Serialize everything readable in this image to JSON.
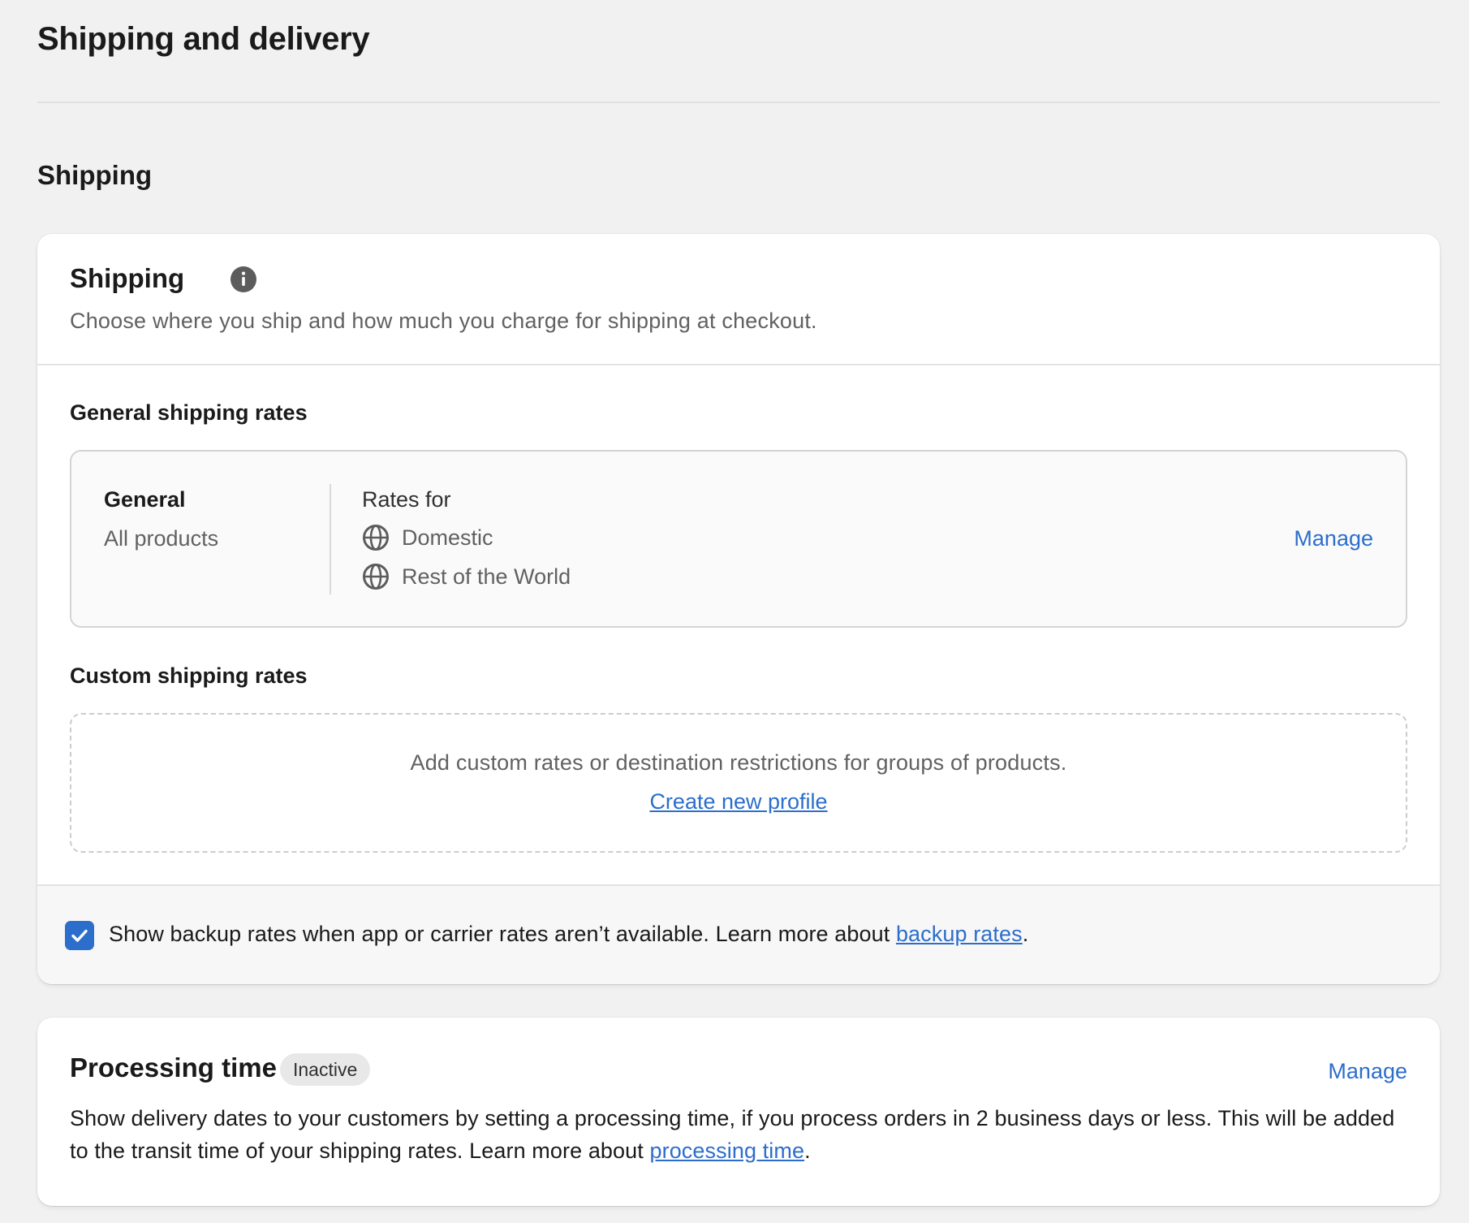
{
  "page": {
    "title": "Shipping and delivery",
    "section_heading": "Shipping"
  },
  "shipping_card": {
    "title": "Shipping",
    "info_icon": "info-icon",
    "subtitle": "Choose where you ship and how much you charge for shipping at checkout.",
    "general_rates": {
      "heading": "General shipping rates",
      "profile_name": "General",
      "profile_scope": "All products",
      "rates_for_label": "Rates for",
      "zones": [
        {
          "icon": "globe-icon",
          "label": "Domestic"
        },
        {
          "icon": "globe-icon",
          "label": "Rest of the World"
        }
      ],
      "manage_label": "Manage"
    },
    "custom_rates": {
      "heading": "Custom shipping rates",
      "description": "Add custom rates or destination restrictions for groups of products.",
      "create_link": "Create new profile"
    },
    "backup": {
      "checked": true,
      "text": "Show backup rates when app or carrier rates aren’t available. Learn more about ",
      "link": "backup rates",
      "suffix": "."
    }
  },
  "processing_card": {
    "title": "Processing time",
    "badge": "Inactive",
    "manage_label": "Manage",
    "description": "Show delivery dates to your customers by setting a processing time, if you process orders in 2 business days or less. This will be added to the transit time of your shipping rates. Learn more about ",
    "link": "processing time",
    "suffix": "."
  },
  "colors": {
    "accent": "#2c6ecb",
    "background": "#f1f1f1",
    "badge_bg": "#e8e8e8"
  }
}
